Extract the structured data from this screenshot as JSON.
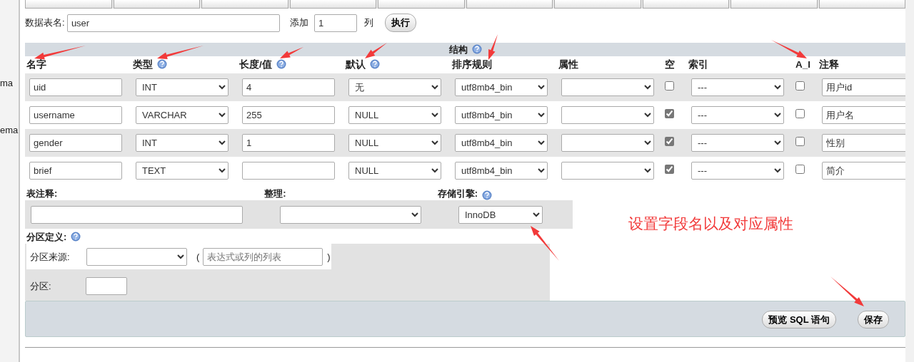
{
  "sidebar": {
    "items": [
      "ma",
      "ema"
    ]
  },
  "table_name": {
    "label": "数据表名:",
    "value": "user"
  },
  "add_columns": {
    "label": "添加",
    "value": "1",
    "unit": "列",
    "button": "执行"
  },
  "structure": {
    "title": "结构",
    "help": true,
    "columns": [
      {
        "label": "名字",
        "help": false
      },
      {
        "label": "类型",
        "help": true
      },
      {
        "label": "长度/值",
        "help": true
      },
      {
        "label": "默认",
        "help": true
      },
      {
        "label": "排序规则",
        "help": false
      },
      {
        "label": "属性",
        "help": false
      },
      {
        "label": "空",
        "help": false
      },
      {
        "label": "索引",
        "help": false
      },
      {
        "label": "A_I",
        "help": false
      },
      {
        "label": "注释",
        "help": false
      }
    ],
    "rows": [
      {
        "name": "uid",
        "type": "INT",
        "length": "4",
        "default": "无",
        "collation": "utf8mb4_bin",
        "null": false,
        "index": "---",
        "ai": false,
        "comment": "用户id"
      },
      {
        "name": "username",
        "type": "VARCHAR",
        "length": "255",
        "default": "NULL",
        "collation": "utf8mb4_bin",
        "null": true,
        "index": "---",
        "ai": false,
        "comment": "用户名"
      },
      {
        "name": "gender",
        "type": "INT",
        "length": "1",
        "default": "NULL",
        "collation": "utf8mb4_bin",
        "null": true,
        "index": "---",
        "ai": false,
        "comment": "性别"
      },
      {
        "name": "brief",
        "type": "TEXT",
        "default": "NULL",
        "collation": "utf8mb4_bin",
        "null": true,
        "index": "---",
        "ai": false,
        "comment": "简介"
      }
    ]
  },
  "table_options": [
    {
      "label": "表注释:",
      "kind": "text",
      "help": false
    },
    {
      "label": "整理:",
      "kind": "select",
      "help": false
    },
    {
      "label": "存储引擎:",
      "kind": "select",
      "value": "InnoDB",
      "help": true
    }
  ],
  "partition": {
    "label": "分区定义:",
    "help": true,
    "source_label": "分区来源:",
    "open_paren": "(",
    "expression_placeholder": "表达式或列的列表",
    "close_paren": ")",
    "partitions_label": "分区:"
  },
  "buttons": [
    {
      "label": "预览 SQL 语句"
    },
    {
      "label": "保存"
    }
  ],
  "annotation": {
    "text": "设置字段名以及对应属性"
  }
}
